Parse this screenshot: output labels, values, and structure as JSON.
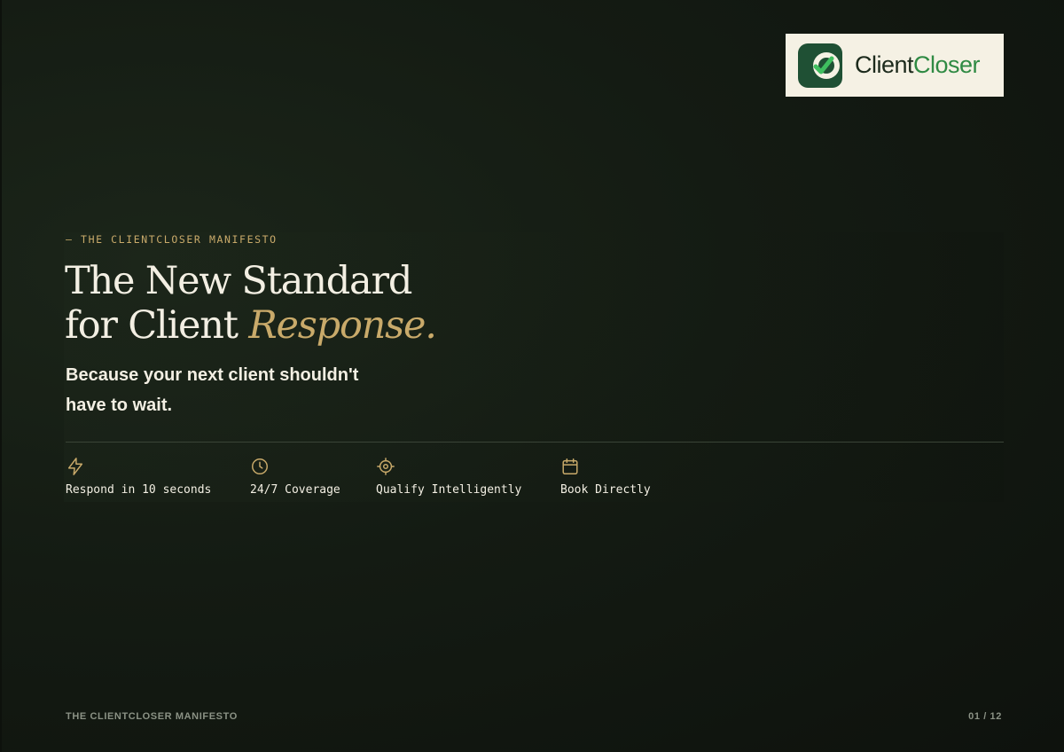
{
  "brand": {
    "name_part1": "Client",
    "name_part2": "Closer",
    "logo_icon": "check-badge-icon",
    "colors": {
      "background": "#141b13",
      "accent_gold": "#c9aa6a",
      "logo_green": "#2f8a43",
      "logo_dark": "#1c2a1c",
      "logo_bg": "#f5f1e4"
    }
  },
  "hero": {
    "eyebrow": "— THE CLIENTCLOSER MANIFESTO",
    "headline_line1": "The New Standard",
    "headline_line2_prefix": "for Client ",
    "headline_line2_accent": "Response.",
    "subhead": "Because your next client shouldn't have to wait."
  },
  "features": [
    {
      "icon": "lightning-icon",
      "label": "Respond in 10 seconds"
    },
    {
      "icon": "clock-icon",
      "label": "24/7 Coverage"
    },
    {
      "icon": "target-icon",
      "label": "Qualify Intelligently"
    },
    {
      "icon": "calendar-icon",
      "label": "Book Directly"
    }
  ],
  "footer": {
    "title": "THE CLIENTCLOSER MANIFESTO",
    "page_indicator": "01 / 12"
  }
}
